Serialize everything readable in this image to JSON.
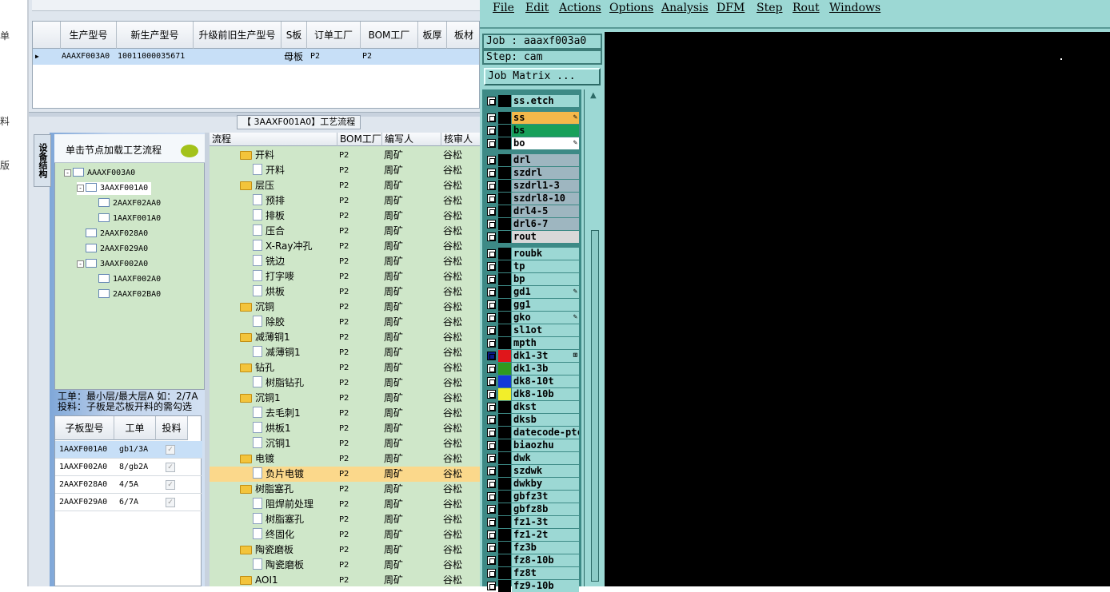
{
  "left_edge_fragments": [
    "单",
    "料",
    "版"
  ],
  "main_grid": {
    "headers": [
      "生产型号",
      "新生产型号",
      "升级前旧生产型号",
      "S板",
      "订单工厂",
      "BOM工厂",
      "板厚",
      "板材"
    ],
    "row": [
      "AAAXF003A0",
      "10011000035671",
      "",
      "母板",
      "P2",
      "P2",
      "",
      ""
    ]
  },
  "flow_title": "【 3AAXF001A0】工艺流程",
  "vertical_tab": "设备结构",
  "tree_header": "单击节点加载工艺流程",
  "tree": [
    {
      "label": "AAAXF003A0",
      "pm": "-"
    },
    {
      "label": "3AAXF001A0",
      "pm": "-"
    },
    {
      "label": "2AAXF02AA0",
      "pm": ""
    },
    {
      "label": "1AAXF001A0",
      "pm": ""
    },
    {
      "label": "2AAXF028A0",
      "pm": ""
    },
    {
      "label": "2AAXF029A0",
      "pm": ""
    },
    {
      "label": "3AAXF002A0",
      "pm": "-"
    },
    {
      "label": "1AAXF002A0",
      "pm": ""
    },
    {
      "label": "2AAXF02BA0",
      "pm": ""
    }
  ],
  "info_line1": "工单：最小层/最大层A 如：2/7A",
  "info_line2": "投料：子板是芯板开料的需勾选",
  "sub_grid": {
    "headers": [
      "子板型号",
      "工单",
      "投料"
    ],
    "rows": [
      {
        "model": "1AAXF001A0",
        "order": "gb1/3A",
        "check": "✓"
      },
      {
        "model": "1AAXF002A0",
        "order": "8/gb2A",
        "check": "✓"
      },
      {
        "model": "2AAXF028A0",
        "order": "4/5A",
        "check": "✓"
      },
      {
        "model": "2AAXF029A0",
        "order": "6/7A",
        "check": "✓"
      }
    ]
  },
  "flow_grid": {
    "headers": [
      "流程",
      "BOM工厂",
      "编写人",
      "核审人"
    ],
    "rows": [
      {
        "name": "开料",
        "folder": true,
        "bom": "P2",
        "writer": "周矿",
        "reviewer": "谷松"
      },
      {
        "name": "开料",
        "folder": false,
        "bom": "P2",
        "writer": "周矿",
        "reviewer": "谷松"
      },
      {
        "name": "层压",
        "folder": true,
        "bom": "P2",
        "writer": "周矿",
        "reviewer": "谷松"
      },
      {
        "name": "预排",
        "folder": false,
        "bom": "P2",
        "writer": "周矿",
        "reviewer": "谷松"
      },
      {
        "name": "排板",
        "folder": false,
        "bom": "P2",
        "writer": "周矿",
        "reviewer": "谷松"
      },
      {
        "name": "压合",
        "folder": false,
        "bom": "P2",
        "writer": "周矿",
        "reviewer": "谷松"
      },
      {
        "name": "X-Ray冲孔",
        "folder": false,
        "bom": "P2",
        "writer": "周矿",
        "reviewer": "谷松"
      },
      {
        "name": "铣边",
        "folder": false,
        "bom": "P2",
        "writer": "周矿",
        "reviewer": "谷松"
      },
      {
        "name": "打字嘜",
        "folder": false,
        "bom": "P2",
        "writer": "周矿",
        "reviewer": "谷松"
      },
      {
        "name": "烘板",
        "folder": false,
        "bom": "P2",
        "writer": "周矿",
        "reviewer": "谷松"
      },
      {
        "name": "沉铜",
        "folder": true,
        "bom": "P2",
        "writer": "周矿",
        "reviewer": "谷松"
      },
      {
        "name": "除胶",
        "folder": false,
        "bom": "P2",
        "writer": "周矿",
        "reviewer": "谷松"
      },
      {
        "name": "减薄铜1",
        "folder": true,
        "bom": "P2",
        "writer": "周矿",
        "reviewer": "谷松"
      },
      {
        "name": "减薄铜1",
        "folder": false,
        "bom": "P2",
        "writer": "周矿",
        "reviewer": "谷松"
      },
      {
        "name": "钻孔",
        "folder": true,
        "bom": "P2",
        "writer": "周矿",
        "reviewer": "谷松"
      },
      {
        "name": "树脂钻孔",
        "folder": false,
        "bom": "P2",
        "writer": "周矿",
        "reviewer": "谷松"
      },
      {
        "name": "沉铜1",
        "folder": true,
        "bom": "P2",
        "writer": "周矿",
        "reviewer": "谷松"
      },
      {
        "name": "去毛刺1",
        "folder": false,
        "bom": "P2",
        "writer": "周矿",
        "reviewer": "谷松"
      },
      {
        "name": "烘板1",
        "folder": false,
        "bom": "P2",
        "writer": "周矿",
        "reviewer": "谷松"
      },
      {
        "name": "沉铜1",
        "folder": false,
        "bom": "P2",
        "writer": "周矿",
        "reviewer": "谷松"
      },
      {
        "name": "电镀",
        "folder": true,
        "bom": "P2",
        "writer": "周矿",
        "reviewer": "谷松"
      },
      {
        "name": "负片电镀",
        "folder": false,
        "bom": "P2",
        "writer": "周矿",
        "reviewer": "谷松",
        "selected": true
      },
      {
        "name": "树脂塞孔",
        "folder": true,
        "bom": "P2",
        "writer": "周矿",
        "reviewer": "谷松"
      },
      {
        "name": "阻焊前处理",
        "folder": false,
        "bom": "P2",
        "writer": "周矿",
        "reviewer": "谷松"
      },
      {
        "name": "树脂塞孔",
        "folder": false,
        "bom": "P2",
        "writer": "周矿",
        "reviewer": "谷松"
      },
      {
        "name": "终固化",
        "folder": false,
        "bom": "P2",
        "writer": "周矿",
        "reviewer": "谷松"
      },
      {
        "name": "陶瓷磨板",
        "folder": true,
        "bom": "P2",
        "writer": "周矿",
        "reviewer": "谷松"
      },
      {
        "name": "陶瓷磨板",
        "folder": false,
        "bom": "P2",
        "writer": "周矿",
        "reviewer": "谷松"
      },
      {
        "name": "AOI1",
        "folder": true,
        "bom": "P2",
        "writer": "周矿",
        "reviewer": "谷松"
      }
    ]
  },
  "cam": {
    "menu": [
      "File",
      "Edit",
      "Actions",
      "Options",
      "Analysis",
      "DFM",
      "Step",
      "Rout",
      "Windows"
    ],
    "job": "Job : aaaxf003a0",
    "step": "Step: cam",
    "job_matrix_button": "Job Matrix ...",
    "layers": [
      {
        "name": "ss.etch",
        "swatch": "#000000",
        "bg": "#9cd8d4",
        "mark": ""
      },
      {
        "name": "ss",
        "swatch": "#000000",
        "bg": "#f5b84a",
        "mark": "✎"
      },
      {
        "name": "bs",
        "swatch": "#000000",
        "bg": "#17a05a",
        "mark": ""
      },
      {
        "name": "bo",
        "swatch": "#000000",
        "bg": "#ffffff",
        "mark": "✎"
      },
      {
        "name": "drl",
        "swatch": "#000000",
        "bg": "#9eb6c0",
        "mark": ""
      },
      {
        "name": "szdrl",
        "swatch": "#000000",
        "bg": "#9eb6c0",
        "mark": ""
      },
      {
        "name": "szdrl1-3",
        "swatch": "#000000",
        "bg": "#9eb6c0",
        "mark": ""
      },
      {
        "name": "szdrl8-10",
        "swatch": "#000000",
        "bg": "#9eb6c0",
        "mark": ""
      },
      {
        "name": "drl4-5",
        "swatch": "#000000",
        "bg": "#9eb6c0",
        "mark": ""
      },
      {
        "name": "drl6-7",
        "swatch": "#000000",
        "bg": "#9eb6c0",
        "mark": ""
      },
      {
        "name": "rout",
        "swatch": "#000000",
        "bg": "#d8d8d8",
        "mark": ""
      },
      {
        "name": "roubk",
        "swatch": "#000000",
        "bg": "#9cd8d4",
        "mark": ""
      },
      {
        "name": "tp",
        "swatch": "#000000",
        "bg": "#9cd8d4",
        "mark": ""
      },
      {
        "name": "bp",
        "swatch": "#000000",
        "bg": "#9cd8d4",
        "mark": ""
      },
      {
        "name": "gd1",
        "swatch": "#000000",
        "bg": "#9cd8d4",
        "mark": "✎"
      },
      {
        "name": "gg1",
        "swatch": "#000000",
        "bg": "#9cd8d4",
        "mark": ""
      },
      {
        "name": "gko",
        "swatch": "#000000",
        "bg": "#9cd8d4",
        "mark": "✎"
      },
      {
        "name": "sl1ot",
        "swatch": "#000000",
        "bg": "#9cd8d4",
        "mark": ""
      },
      {
        "name": "mpth",
        "swatch": "#000000",
        "bg": "#9cd8d4",
        "mark": ""
      },
      {
        "name": "dk1-3t",
        "swatch": "#e0161b",
        "bg": "#9cd8d4",
        "mark": "⊞",
        "cb_dark": true
      },
      {
        "name": "dk1-3b",
        "swatch": "#2f9a1f",
        "bg": "#9cd8d4",
        "mark": ""
      },
      {
        "name": "dk8-10t",
        "swatch": "#1438d8",
        "bg": "#9cd8d4",
        "mark": ""
      },
      {
        "name": "dk8-10b",
        "swatch": "#f2ee2a",
        "bg": "#9cd8d4",
        "mark": ""
      },
      {
        "name": "dkst",
        "swatch": "#000000",
        "bg": "#9cd8d4",
        "mark": ""
      },
      {
        "name": "dksb",
        "swatch": "#000000",
        "bg": "#9cd8d4",
        "mark": ""
      },
      {
        "name": "datecode-ptc",
        "swatch": "#000000",
        "bg": "#9cd8d4",
        "mark": ""
      },
      {
        "name": "biaozhu",
        "swatch": "#000000",
        "bg": "#9cd8d4",
        "mark": ""
      },
      {
        "name": "dwk",
        "swatch": "#000000",
        "bg": "#9cd8d4",
        "mark": ""
      },
      {
        "name": "szdwk",
        "swatch": "#000000",
        "bg": "#9cd8d4",
        "mark": ""
      },
      {
        "name": "dwkby",
        "swatch": "#000000",
        "bg": "#9cd8d4",
        "mark": ""
      },
      {
        "name": "gbfz3t",
        "swatch": "#000000",
        "bg": "#9cd8d4",
        "mark": ""
      },
      {
        "name": "gbfz8b",
        "swatch": "#000000",
        "bg": "#9cd8d4",
        "mark": ""
      },
      {
        "name": "fz1-3t",
        "swatch": "#000000",
        "bg": "#9cd8d4",
        "mark": ""
      },
      {
        "name": "fz1-2t",
        "swatch": "#000000",
        "bg": "#9cd8d4",
        "mark": ""
      },
      {
        "name": "fz3b",
        "swatch": "#000000",
        "bg": "#9cd8d4",
        "mark": ""
      },
      {
        "name": "fz8-10b",
        "swatch": "#000000",
        "bg": "#9cd8d4",
        "mark": ""
      },
      {
        "name": "fz8t",
        "swatch": "#000000",
        "bg": "#9cd8d4",
        "mark": ""
      },
      {
        "name": "fz9-10b",
        "swatch": "#000000",
        "bg": "#9cd8d4",
        "mark": ""
      }
    ]
  }
}
